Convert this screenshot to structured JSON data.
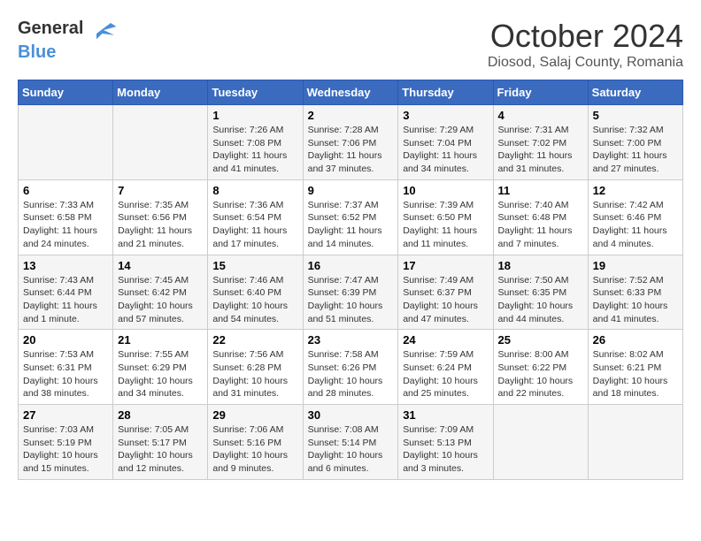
{
  "header": {
    "logo_general": "General",
    "logo_blue": "Blue",
    "month_title": "October 2024",
    "location": "Diosod, Salaj County, Romania"
  },
  "days_of_week": [
    "Sunday",
    "Monday",
    "Tuesday",
    "Wednesday",
    "Thursday",
    "Friday",
    "Saturday"
  ],
  "weeks": [
    [
      {
        "day": "",
        "info": ""
      },
      {
        "day": "",
        "info": ""
      },
      {
        "day": "1",
        "info": "Sunrise: 7:26 AM\nSunset: 7:08 PM\nDaylight: 11 hours and 41 minutes."
      },
      {
        "day": "2",
        "info": "Sunrise: 7:28 AM\nSunset: 7:06 PM\nDaylight: 11 hours and 37 minutes."
      },
      {
        "day": "3",
        "info": "Sunrise: 7:29 AM\nSunset: 7:04 PM\nDaylight: 11 hours and 34 minutes."
      },
      {
        "day": "4",
        "info": "Sunrise: 7:31 AM\nSunset: 7:02 PM\nDaylight: 11 hours and 31 minutes."
      },
      {
        "day": "5",
        "info": "Sunrise: 7:32 AM\nSunset: 7:00 PM\nDaylight: 11 hours and 27 minutes."
      }
    ],
    [
      {
        "day": "6",
        "info": "Sunrise: 7:33 AM\nSunset: 6:58 PM\nDaylight: 11 hours and 24 minutes."
      },
      {
        "day": "7",
        "info": "Sunrise: 7:35 AM\nSunset: 6:56 PM\nDaylight: 11 hours and 21 minutes."
      },
      {
        "day": "8",
        "info": "Sunrise: 7:36 AM\nSunset: 6:54 PM\nDaylight: 11 hours and 17 minutes."
      },
      {
        "day": "9",
        "info": "Sunrise: 7:37 AM\nSunset: 6:52 PM\nDaylight: 11 hours and 14 minutes."
      },
      {
        "day": "10",
        "info": "Sunrise: 7:39 AM\nSunset: 6:50 PM\nDaylight: 11 hours and 11 minutes."
      },
      {
        "day": "11",
        "info": "Sunrise: 7:40 AM\nSunset: 6:48 PM\nDaylight: 11 hours and 7 minutes."
      },
      {
        "day": "12",
        "info": "Sunrise: 7:42 AM\nSunset: 6:46 PM\nDaylight: 11 hours and 4 minutes."
      }
    ],
    [
      {
        "day": "13",
        "info": "Sunrise: 7:43 AM\nSunset: 6:44 PM\nDaylight: 11 hours and 1 minute."
      },
      {
        "day": "14",
        "info": "Sunrise: 7:45 AM\nSunset: 6:42 PM\nDaylight: 10 hours and 57 minutes."
      },
      {
        "day": "15",
        "info": "Sunrise: 7:46 AM\nSunset: 6:40 PM\nDaylight: 10 hours and 54 minutes."
      },
      {
        "day": "16",
        "info": "Sunrise: 7:47 AM\nSunset: 6:39 PM\nDaylight: 10 hours and 51 minutes."
      },
      {
        "day": "17",
        "info": "Sunrise: 7:49 AM\nSunset: 6:37 PM\nDaylight: 10 hours and 47 minutes."
      },
      {
        "day": "18",
        "info": "Sunrise: 7:50 AM\nSunset: 6:35 PM\nDaylight: 10 hours and 44 minutes."
      },
      {
        "day": "19",
        "info": "Sunrise: 7:52 AM\nSunset: 6:33 PM\nDaylight: 10 hours and 41 minutes."
      }
    ],
    [
      {
        "day": "20",
        "info": "Sunrise: 7:53 AM\nSunset: 6:31 PM\nDaylight: 10 hours and 38 minutes."
      },
      {
        "day": "21",
        "info": "Sunrise: 7:55 AM\nSunset: 6:29 PM\nDaylight: 10 hours and 34 minutes."
      },
      {
        "day": "22",
        "info": "Sunrise: 7:56 AM\nSunset: 6:28 PM\nDaylight: 10 hours and 31 minutes."
      },
      {
        "day": "23",
        "info": "Sunrise: 7:58 AM\nSunset: 6:26 PM\nDaylight: 10 hours and 28 minutes."
      },
      {
        "day": "24",
        "info": "Sunrise: 7:59 AM\nSunset: 6:24 PM\nDaylight: 10 hours and 25 minutes."
      },
      {
        "day": "25",
        "info": "Sunrise: 8:00 AM\nSunset: 6:22 PM\nDaylight: 10 hours and 22 minutes."
      },
      {
        "day": "26",
        "info": "Sunrise: 8:02 AM\nSunset: 6:21 PM\nDaylight: 10 hours and 18 minutes."
      }
    ],
    [
      {
        "day": "27",
        "info": "Sunrise: 7:03 AM\nSunset: 5:19 PM\nDaylight: 10 hours and 15 minutes."
      },
      {
        "day": "28",
        "info": "Sunrise: 7:05 AM\nSunset: 5:17 PM\nDaylight: 10 hours and 12 minutes."
      },
      {
        "day": "29",
        "info": "Sunrise: 7:06 AM\nSunset: 5:16 PM\nDaylight: 10 hours and 9 minutes."
      },
      {
        "day": "30",
        "info": "Sunrise: 7:08 AM\nSunset: 5:14 PM\nDaylight: 10 hours and 6 minutes."
      },
      {
        "day": "31",
        "info": "Sunrise: 7:09 AM\nSunset: 5:13 PM\nDaylight: 10 hours and 3 minutes."
      },
      {
        "day": "",
        "info": ""
      },
      {
        "day": "",
        "info": ""
      }
    ]
  ]
}
